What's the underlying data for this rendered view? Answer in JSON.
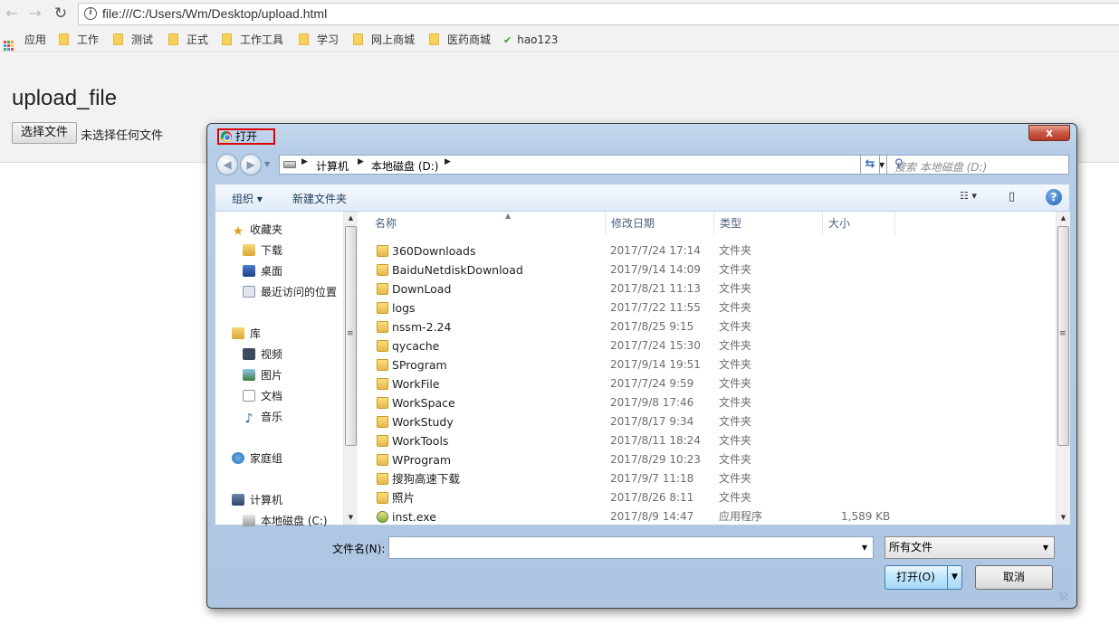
{
  "browser": {
    "url": "file:///C:/Users/Wm/Desktop/upload.html",
    "bookmarks": [
      "应用",
      "工作",
      "测试",
      "正式",
      "工作工具",
      "学习",
      "网上商城",
      "医药商城",
      "hao123"
    ]
  },
  "page": {
    "heading": "upload_file",
    "choose_button": "选择文件",
    "no_file_text": "未选择任何文件"
  },
  "dialog": {
    "title": "打开",
    "close_label": "x",
    "breadcrumb": [
      "计算机",
      "本地磁盘 (D:)"
    ],
    "search_placeholder": "搜索 本地磁盘 (D:)",
    "toolbar": {
      "organize": "组织 ▾",
      "new_folder": "新建文件夹"
    },
    "nav": {
      "favorites": "收藏夹",
      "downloads": "下载",
      "desktop": "桌面",
      "recent": "最近访问的位置",
      "libraries": "库",
      "videos": "视频",
      "pictures": "图片",
      "documents": "文档",
      "music": "音乐",
      "homegroup": "家庭组",
      "computer": "计算机",
      "disk_c": "本地磁盘 (C:)"
    },
    "columns": {
      "name": "名称",
      "date": "修改日期",
      "type": "类型",
      "size": "大小"
    },
    "files": [
      {
        "name": "360Downloads",
        "date": "2017/7/24 17:14",
        "type": "文件夹",
        "size": ""
      },
      {
        "name": "BaiduNetdiskDownload",
        "date": "2017/9/14 14:09",
        "type": "文件夹",
        "size": ""
      },
      {
        "name": "DownLoad",
        "date": "2017/8/21 11:13",
        "type": "文件夹",
        "size": ""
      },
      {
        "name": "logs",
        "date": "2017/7/22 11:55",
        "type": "文件夹",
        "size": ""
      },
      {
        "name": "nssm-2.24",
        "date": "2017/8/25 9:15",
        "type": "文件夹",
        "size": ""
      },
      {
        "name": "qycache",
        "date": "2017/7/24 15:30",
        "type": "文件夹",
        "size": ""
      },
      {
        "name": "SProgram",
        "date": "2017/9/14 19:51",
        "type": "文件夹",
        "size": ""
      },
      {
        "name": "WorkFile",
        "date": "2017/7/24 9:59",
        "type": "文件夹",
        "size": ""
      },
      {
        "name": "WorkSpace",
        "date": "2017/9/8 17:46",
        "type": "文件夹",
        "size": ""
      },
      {
        "name": "WorkStudy",
        "date": "2017/8/17 9:34",
        "type": "文件夹",
        "size": ""
      },
      {
        "name": "WorkTools",
        "date": "2017/8/11 18:24",
        "type": "文件夹",
        "size": ""
      },
      {
        "name": "WProgram",
        "date": "2017/8/29 10:23",
        "type": "文件夹",
        "size": ""
      },
      {
        "name": "搜狗高速下载",
        "date": "2017/9/7 11:18",
        "type": "文件夹",
        "size": ""
      },
      {
        "name": "照片",
        "date": "2017/8/26 8:11",
        "type": "文件夹",
        "size": ""
      },
      {
        "name": "inst.exe",
        "date": "2017/8/9 14:47",
        "type": "应用程序",
        "size": "1,589 KB"
      }
    ],
    "filename_label": "文件名(N):",
    "filename_value": "",
    "filter_value": "所有文件",
    "open_button": "打开(O)",
    "cancel_button": "取消"
  }
}
